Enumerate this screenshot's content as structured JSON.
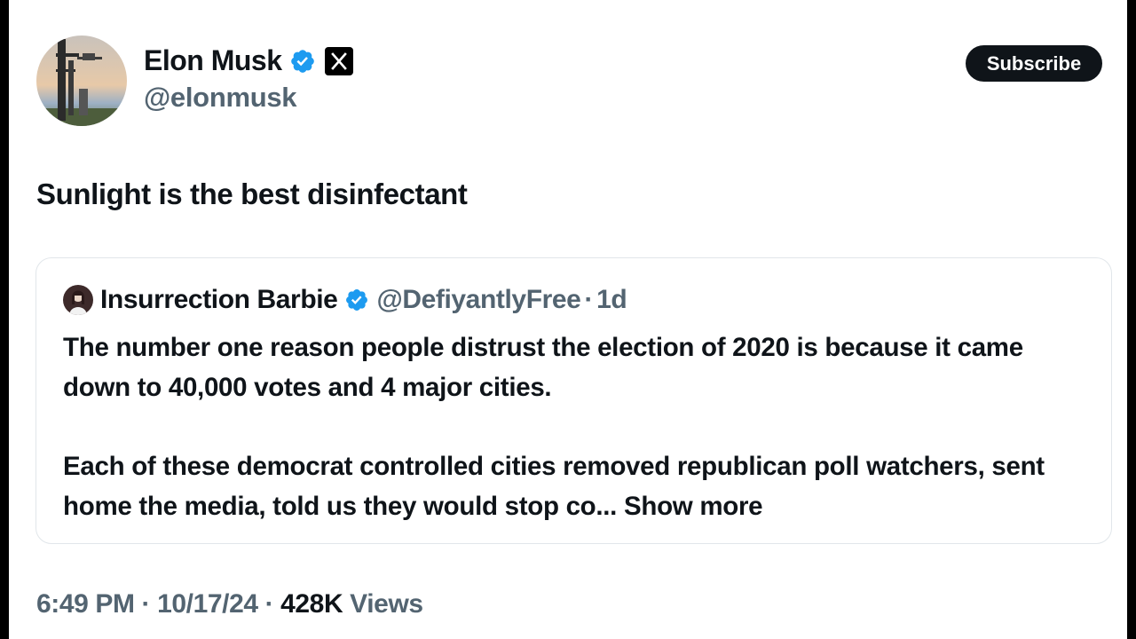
{
  "author": {
    "name": "Elon Musk",
    "handle": "@elonmusk"
  },
  "header": {
    "subscribe_label": "Subscribe"
  },
  "tweet": {
    "text": "Sunlight is the best disinfectant"
  },
  "quote": {
    "name": "Insurrection Barbie",
    "handle": "@DefiyantlyFree",
    "separator": "·",
    "time": "1d",
    "paragraph1": "The number one reason people distrust the election of 2020 is because it came down to 40,000 votes and 4 major cities.",
    "paragraph2": "Each of these democrat controlled cities removed republican poll watchers, sent home the media, told us they would stop co...",
    "show_more": "Show more"
  },
  "meta": {
    "time": "6:49 PM",
    "separator": "·",
    "date": "10/17/24",
    "views_count": "428K",
    "views_label": "Views"
  },
  "colors": {
    "verified_blue": "#1d9bf0",
    "text_primary": "#0f1419",
    "text_secondary": "#536471",
    "border": "#e1e6ea"
  },
  "icons": {
    "verified": "verified-badge-icon",
    "affiliation": "x-logo-icon"
  }
}
